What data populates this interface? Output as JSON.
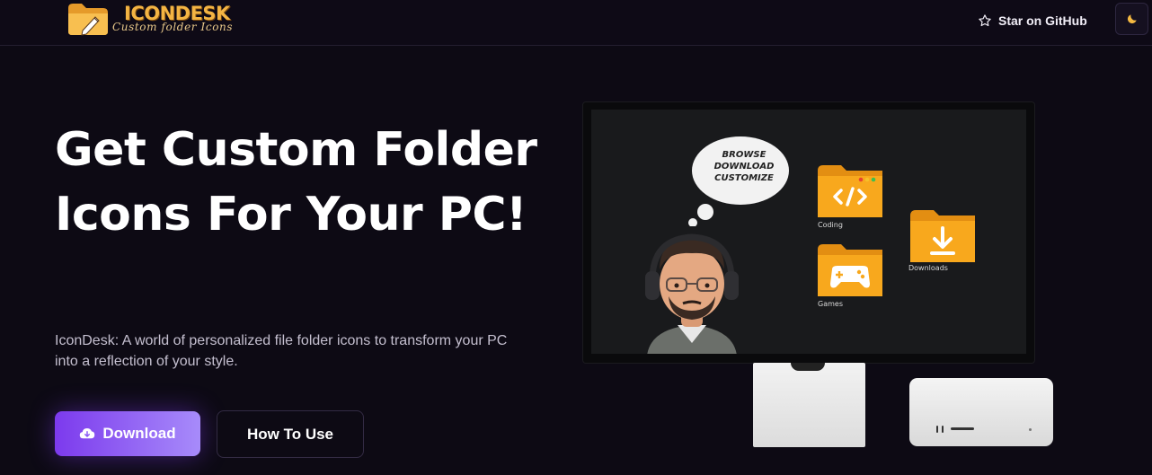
{
  "header": {
    "brand_name": "ICONDESK",
    "brand_tagline": "Custom folder Icons",
    "github_label": "Star on GitHub",
    "icons": {
      "logo": "folder-pencil-icon",
      "github": "star-icon",
      "theme": "moon-icon"
    }
  },
  "hero": {
    "title": "Get Custom Folder Icons For Your PC!",
    "description": "IconDesk: A world of personalized file folder icons to transform your PC into a reflection of your style.",
    "download_label": "Download",
    "howto_label": "How To Use",
    "download_icon": "cloud-download-icon"
  },
  "illustration": {
    "bubble_lines": [
      "BROWSE",
      "DOWNLOAD",
      "CUSTOMIZE"
    ],
    "folders": [
      {
        "label": "Coding",
        "icon": "code-icon"
      },
      {
        "label": "Downloads",
        "icon": "download-arrow-icon"
      },
      {
        "label": "Games",
        "icon": "gamepad-icon"
      }
    ]
  },
  "colors": {
    "background": "#0d0a14",
    "accent_start": "#7c3aed",
    "accent_end": "#a78bfa",
    "folder": "#f5a623",
    "brand": "#f3b443"
  }
}
